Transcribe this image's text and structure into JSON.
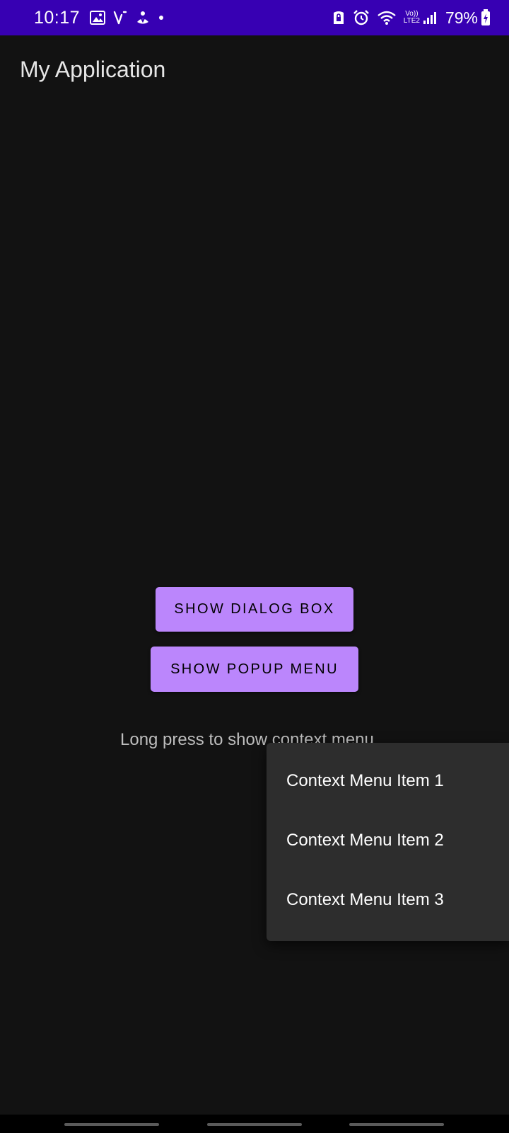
{
  "status_bar": {
    "time": "10:17",
    "battery_percent": "79%",
    "volte_label_top": "Vo))",
    "volte_label_bottom": "LTE2",
    "left_icons": [
      "image-icon",
      "signal-path-icon",
      "app-notification-icon",
      "dot-icon"
    ],
    "right_icons": [
      "vpn-lock-icon",
      "alarm-icon",
      "wifi-icon",
      "volte-icon",
      "cell-signal-icon",
      "battery-charging-icon"
    ],
    "background_color": "#3700B3"
  },
  "app_bar": {
    "title": "My Application"
  },
  "main": {
    "show_dialog_label": "SHOW DIALOG BOX",
    "show_popup_label": "SHOW POPUP MENU",
    "hint": "Long press to show context menu"
  },
  "context_menu": {
    "items": [
      {
        "label": "Context Menu Item 1"
      },
      {
        "label": "Context Menu Item 2"
      },
      {
        "label": "Context Menu Item 3"
      }
    ]
  },
  "colors": {
    "accent": "#BB86FC",
    "background": "#121212",
    "menu_background": "#2D2D2D"
  }
}
